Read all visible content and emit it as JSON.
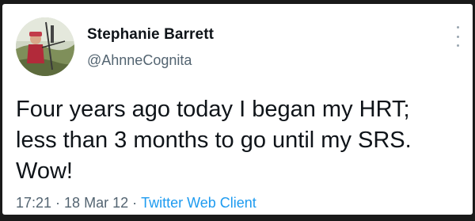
{
  "tweet": {
    "author": {
      "display_name": "Stephanie Barrett",
      "handle": "@AhnneCognita",
      "avatar_icon": "archer-photo-avatar"
    },
    "text": "Four years ago today I began my HRT;\nless than 3 months to go until my SRS.\nWow!",
    "time": "17:21",
    "date": "18 Mar 12",
    "separator": "·",
    "client": "Twitter Web Client",
    "more_icon": "vertical-ellipsis-icon"
  },
  "colors": {
    "text_primary": "#0f1419",
    "text_secondary": "#536471",
    "link": "#1d9bf0",
    "background": "#ffffff",
    "frame": "#1a1a1a"
  }
}
